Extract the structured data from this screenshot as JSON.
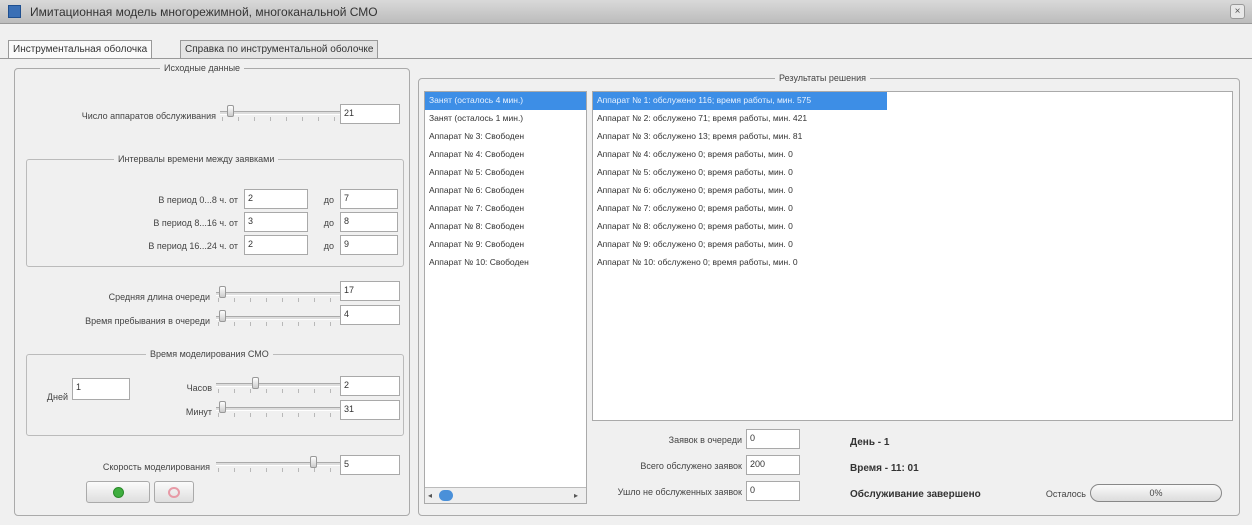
{
  "window": {
    "title": "Имитационная модель многорежимной, многоканальной СМО",
    "close_symbol": "×"
  },
  "tabs": [
    {
      "label": "Инструментальная оболочка",
      "active": true
    },
    {
      "label": "Справка по инструментальной оболочке",
      "active": false
    }
  ],
  "input_data": {
    "title": "Исходные данные",
    "devices_label": "Число аппаратов обслуживания",
    "devices_value": "21",
    "devices_level": 0.05,
    "intervals": {
      "title": "Интервалы времени между заявками",
      "rows": [
        {
          "label": "В период 0...8 ч. от",
          "from": "2",
          "to_label": "до",
          "to": "7"
        },
        {
          "label": "В период 8...16 ч. от",
          "from": "3",
          "to_label": "до",
          "to": "8"
        },
        {
          "label": "В период 16...24 ч. от",
          "from": "2",
          "to_label": "до",
          "to": "9"
        }
      ]
    },
    "queue_len_label": "Средняя длина очереди",
    "queue_len_value": "17",
    "queue_len_level": 0.02,
    "queue_time_label": "Время пребывания в очереди",
    "queue_time_value": "4",
    "queue_time_level": 0.02,
    "sim_time": {
      "title": "Время моделирования СМО",
      "days_label": "Дней",
      "days_value": "1",
      "hours_label": "Часов",
      "hours_value": "2",
      "hours_level": 0.3,
      "minutes_label": "Минут",
      "minutes_value": "31",
      "minutes_level": 0.02
    },
    "speed_label": "Скорость моделирования",
    "speed_value": "5",
    "speed_level": 0.8
  },
  "results": {
    "title": "Результаты решения",
    "status_list": [
      "Занят (осталось 4 мин.)",
      "Занят (осталось 1 мин.)",
      "Аппарат № 3: Свободен",
      "Аппарат № 4: Свободен",
      "Аппарат № 5: Свободен",
      "Аппарат № 6: Свободен",
      "Аппарат № 7: Свободен",
      "Аппарат № 8: Свободен",
      "Аппарат № 9: Свободен",
      "Аппарат № 10: Свободен"
    ],
    "stats_list": [
      "Аппарат № 1: обслужено 116; время работы, мин. 575",
      "Аппарат № 2: обслужено 71; время работы, мин. 421",
      "Аппарат № 3: обслужено 13; время работы, мин. 81",
      "Аппарат № 4: обслужено 0; время работы, мин. 0",
      "Аппарат № 5: обслужено 0; время работы, мин. 0",
      "Аппарат № 6: обслужено 0; время работы, мин. 0",
      "Аппарат № 7: обслужено 0; время работы, мин. 0",
      "Аппарат № 8: обслужено 0; время работы, мин. 0",
      "Аппарат № 9: обслужено 0; время работы, мин. 0",
      "Аппарат № 10: обслужено 0; время работы, мин. 0"
    ],
    "in_queue_label": "Заявок в очереди",
    "in_queue_value": "0",
    "served_label": "Всего обслужено заявок",
    "served_value": "200",
    "lost_label": "Ушло не обслуженных заявок",
    "lost_value": "0",
    "day_text": "День - 1",
    "time_text": "Время - 11: 01",
    "done_text": "Обслуживание завершено",
    "remaining_label": "Осталось",
    "progress_text": "0%",
    "progress_fraction": 0
  },
  "colors": {
    "selection": "#3d8ee6",
    "start_button": "#3fae3f",
    "stop_button": "#e79aa6"
  },
  "icons": {
    "app": "app-icon",
    "start": "play-icon",
    "stop": "stop-icon"
  }
}
